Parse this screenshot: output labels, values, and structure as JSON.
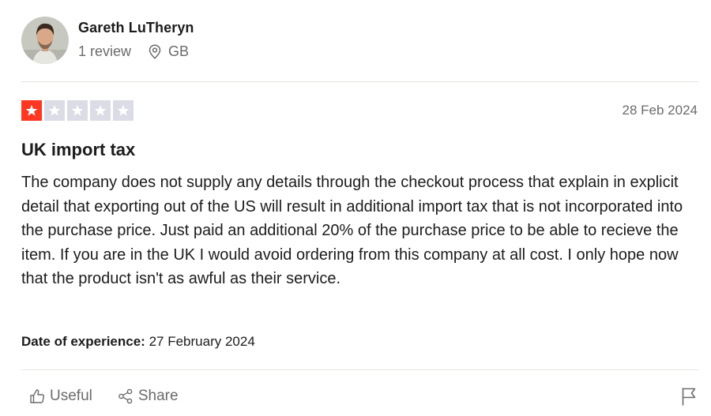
{
  "consumer": {
    "name": "Gareth LuTheryn",
    "review_count": "1 review",
    "country": "GB"
  },
  "review": {
    "rating": 1,
    "max_rating": 5,
    "date": "28 Feb 2024",
    "title": "UK import tax",
    "body": "The company does not supply any details through the checkout process that explain in explicit detail that exporting out of the US will result in additional import tax that is not incorporated into the purchase price. Just paid an additional 20% of the purchase price to be able to recieve the item. If you are in the UK I would avoid ordering from this company at all cost. I only hope now that the product isn't as awful as their service.",
    "experience_label": "Date of experience:",
    "experience_date": "27 February 2024"
  },
  "actions": {
    "useful_label": "Useful",
    "share_label": "Share"
  },
  "icons": {
    "location": "location-pin-icon",
    "useful": "thumbs-up-icon",
    "share": "share-icon",
    "report": "flag-icon"
  },
  "colors": {
    "star_active": "#ff3722",
    "star_inactive": "#dcdce6",
    "muted_text": "#6b6b6b"
  }
}
